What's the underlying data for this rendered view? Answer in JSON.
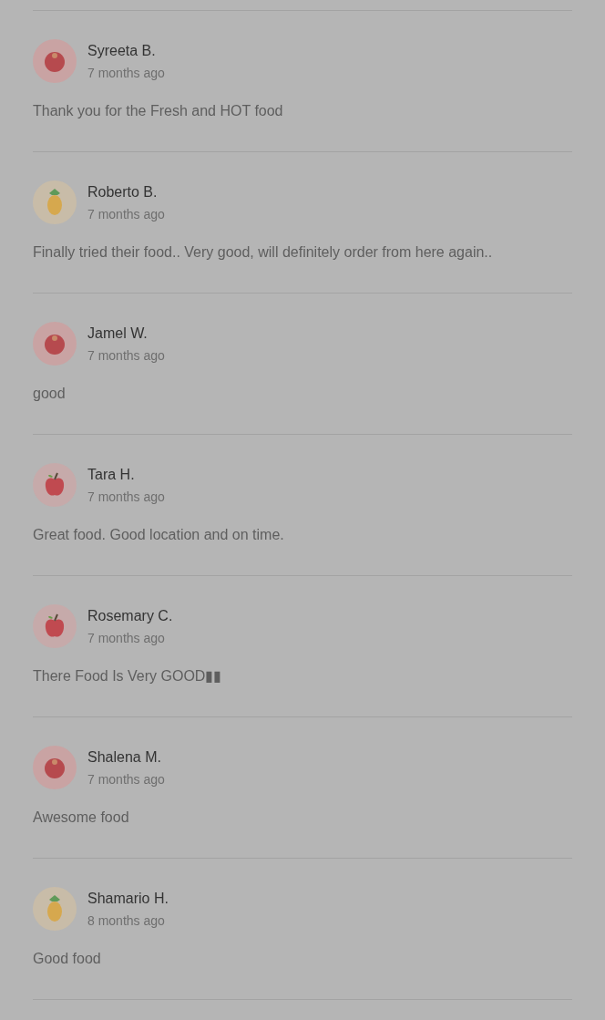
{
  "reviews": [
    {
      "name": "Syreeta B.",
      "time": "7 months ago",
      "text": "Thank you for the Fresh and HOT food",
      "avatar": {
        "kind": "tomato"
      }
    },
    {
      "name": "Roberto B.",
      "time": "7 months ago",
      "text": "Finally tried their food.. Very good, will definitely order from here again..",
      "avatar": {
        "kind": "pineapple"
      }
    },
    {
      "name": "Jamel W.",
      "time": "7 months ago",
      "text": "good",
      "avatar": {
        "kind": "tomato"
      }
    },
    {
      "name": "Tara H.",
      "time": "7 months ago",
      "text": "Great food. Good location and on time.",
      "avatar": {
        "kind": "apple"
      }
    },
    {
      "name": "Rosemary C.",
      "time": "7 months ago",
      "text": "There Food Is Very GOOD▮▮",
      "avatar": {
        "kind": "apple"
      }
    },
    {
      "name": "Shalena M.",
      "time": "7 months ago",
      "text": "Awesome food",
      "avatar": {
        "kind": "tomato"
      }
    },
    {
      "name": "Shamario H.",
      "time": "8 months ago",
      "text": "Good food",
      "avatar": {
        "kind": "pineapple"
      }
    }
  ]
}
